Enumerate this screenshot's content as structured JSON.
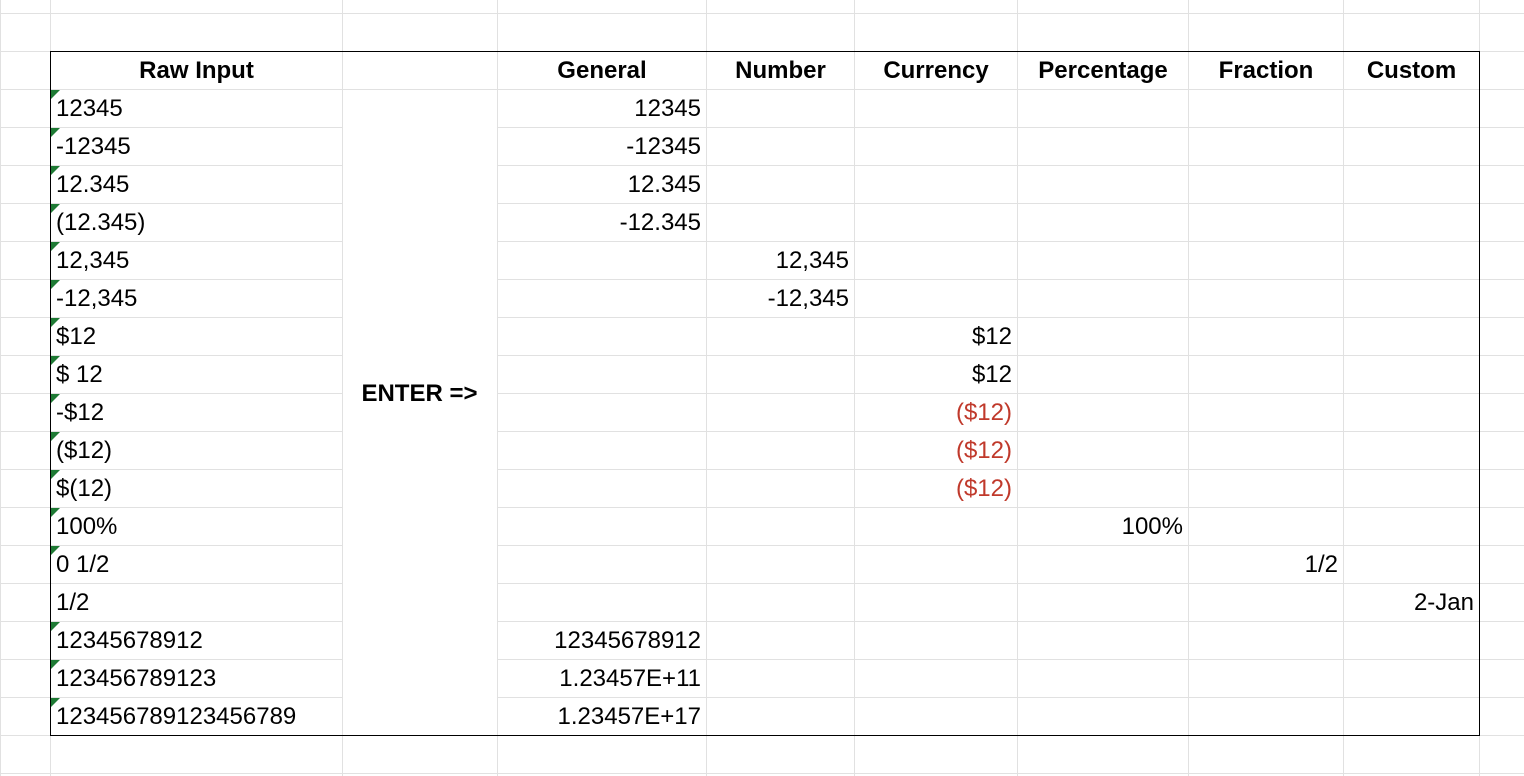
{
  "headers": {
    "raw_input": "Raw Input",
    "general": "General",
    "number": "Number",
    "currency": "Currency",
    "percentage": "Percentage",
    "fraction": "Fraction",
    "custom": "Custom"
  },
  "enter_label": "ENTER =>",
  "rows": [
    {
      "raw": "12345",
      "general": "12345"
    },
    {
      "raw": "-12345",
      "general": "-12345"
    },
    {
      "raw": "12.345",
      "general": "12.345"
    },
    {
      "raw": "(12.345)",
      "general": "-12.345"
    },
    {
      "raw": "12,345",
      "number": "12,345"
    },
    {
      "raw": "-12,345",
      "number": "-12,345"
    },
    {
      "raw": "$12",
      "currency": "$12"
    },
    {
      "raw": "$ 12",
      "currency": "$12"
    },
    {
      "raw": "-$12",
      "currency": "($12)"
    },
    {
      "raw": "($12)",
      "currency": "($12)"
    },
    {
      "raw": "$(12)",
      "currency": "($12)"
    },
    {
      "raw": "100%",
      "percentage": "100%"
    },
    {
      "raw": "0 1/2",
      "fraction": "1/2"
    },
    {
      "raw": "1/2",
      "custom": "2-Jan"
    },
    {
      "raw": "12345678912",
      "general": "12345678912"
    },
    {
      "raw": "123456789123",
      "general": "1.23457E+11"
    },
    {
      "raw": "123456789123456789",
      "general": "1.23457E+17"
    }
  ],
  "colors": {
    "gridline": "#e1e1e1",
    "border": "#000000",
    "text_indicator": "#1e7a34",
    "negative_red": "#c0392b"
  }
}
